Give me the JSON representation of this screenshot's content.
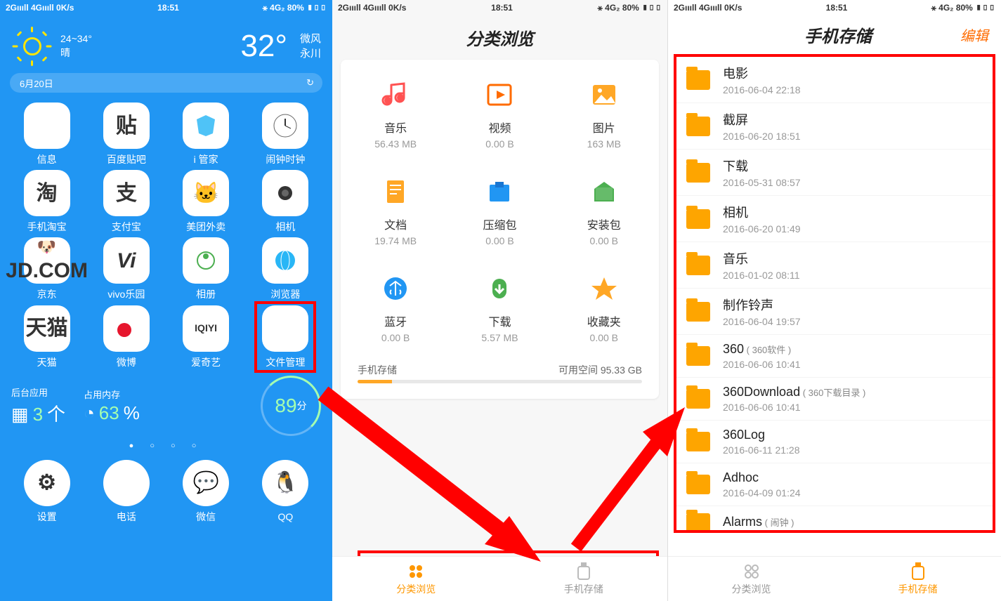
{
  "statusbar": {
    "left": "2Gıııll 4Gıııll 0K/s",
    "center": "18:51",
    "right": "⚹ 4G₂ 80% ▮▯▯"
  },
  "screen1": {
    "weather": {
      "range": "24~34°",
      "desc": "晴",
      "temp": "32°",
      "wind": "微风",
      "city": "永川"
    },
    "date": "6月20日",
    "apps": {
      "r1": [
        "信息",
        "百度贴吧",
        "i 管家",
        "闹钟时钟"
      ],
      "r2": [
        "手机淘宝",
        "支付宝",
        "美团外卖",
        "相机"
      ],
      "r3": [
        "京东",
        "vivo乐园",
        "相册",
        "浏览器"
      ],
      "r4": [
        "天猫",
        "微博",
        "爱奇艺",
        "文件管理"
      ]
    },
    "widgets": {
      "bg_label": "后台应用",
      "bg_val": "3",
      "bg_unit": "个",
      "mem_label": "占用内存",
      "mem_val": "63",
      "mem_unit": "%",
      "score": "89",
      "score_unit": "分"
    },
    "dock": [
      "设置",
      "电话",
      "微信",
      "QQ"
    ]
  },
  "screen2": {
    "title": "分类浏览",
    "cats": [
      {
        "name": "音乐",
        "size": "56.43 MB"
      },
      {
        "name": "视频",
        "size": "0.00 B"
      },
      {
        "name": "图片",
        "size": "163 MB"
      },
      {
        "name": "文档",
        "size": "19.74 MB"
      },
      {
        "name": "压缩包",
        "size": "0.00 B"
      },
      {
        "name": "安装包",
        "size": "0.00 B"
      },
      {
        "name": "蓝牙",
        "size": "0.00 B"
      },
      {
        "name": "下载",
        "size": "5.57 MB"
      },
      {
        "name": "收藏夹",
        "size": "0.00 B"
      }
    ],
    "storage_label": "手机存储",
    "free_label": "可用空间",
    "free_val": "95.33 GB",
    "tabs": {
      "a": "分类浏览",
      "b": "手机存储"
    }
  },
  "screen3": {
    "title": "手机存储",
    "edit": "编辑",
    "folders": [
      {
        "name": "电影",
        "date": "2016-06-04 22:18"
      },
      {
        "name": "截屏",
        "date": "2016-06-20 18:51"
      },
      {
        "name": "下载",
        "date": "2016-05-31 08:57"
      },
      {
        "name": "相机",
        "date": "2016-06-20 01:49"
      },
      {
        "name": "音乐",
        "date": "2016-01-02 08:11"
      },
      {
        "name": "制作铃声",
        "date": "2016-06-04 19:57"
      },
      {
        "name": "360",
        "sub": "( 360软件 )",
        "date": "2016-06-06 10:41"
      },
      {
        "name": "360Download",
        "sub": "( 360下载目录 )",
        "date": "2016-06-06 10:41"
      },
      {
        "name": "360Log",
        "date": "2016-06-11 21:28"
      },
      {
        "name": "Adhoc",
        "date": "2016-04-09 01:24"
      },
      {
        "name": "Alarms",
        "sub": "( 闹钟 )",
        "date": ""
      }
    ],
    "tabs": {
      "a": "分类浏览",
      "b": "手机存储"
    }
  },
  "icons": {
    "tieba": "贴",
    "taobao": "淘",
    "alipay": "支",
    "jd": "JD.COM",
    "vivo": "Vi",
    "tmall": "天猫",
    "weibo": "👤",
    "iqiyi": "IQIYI"
  }
}
